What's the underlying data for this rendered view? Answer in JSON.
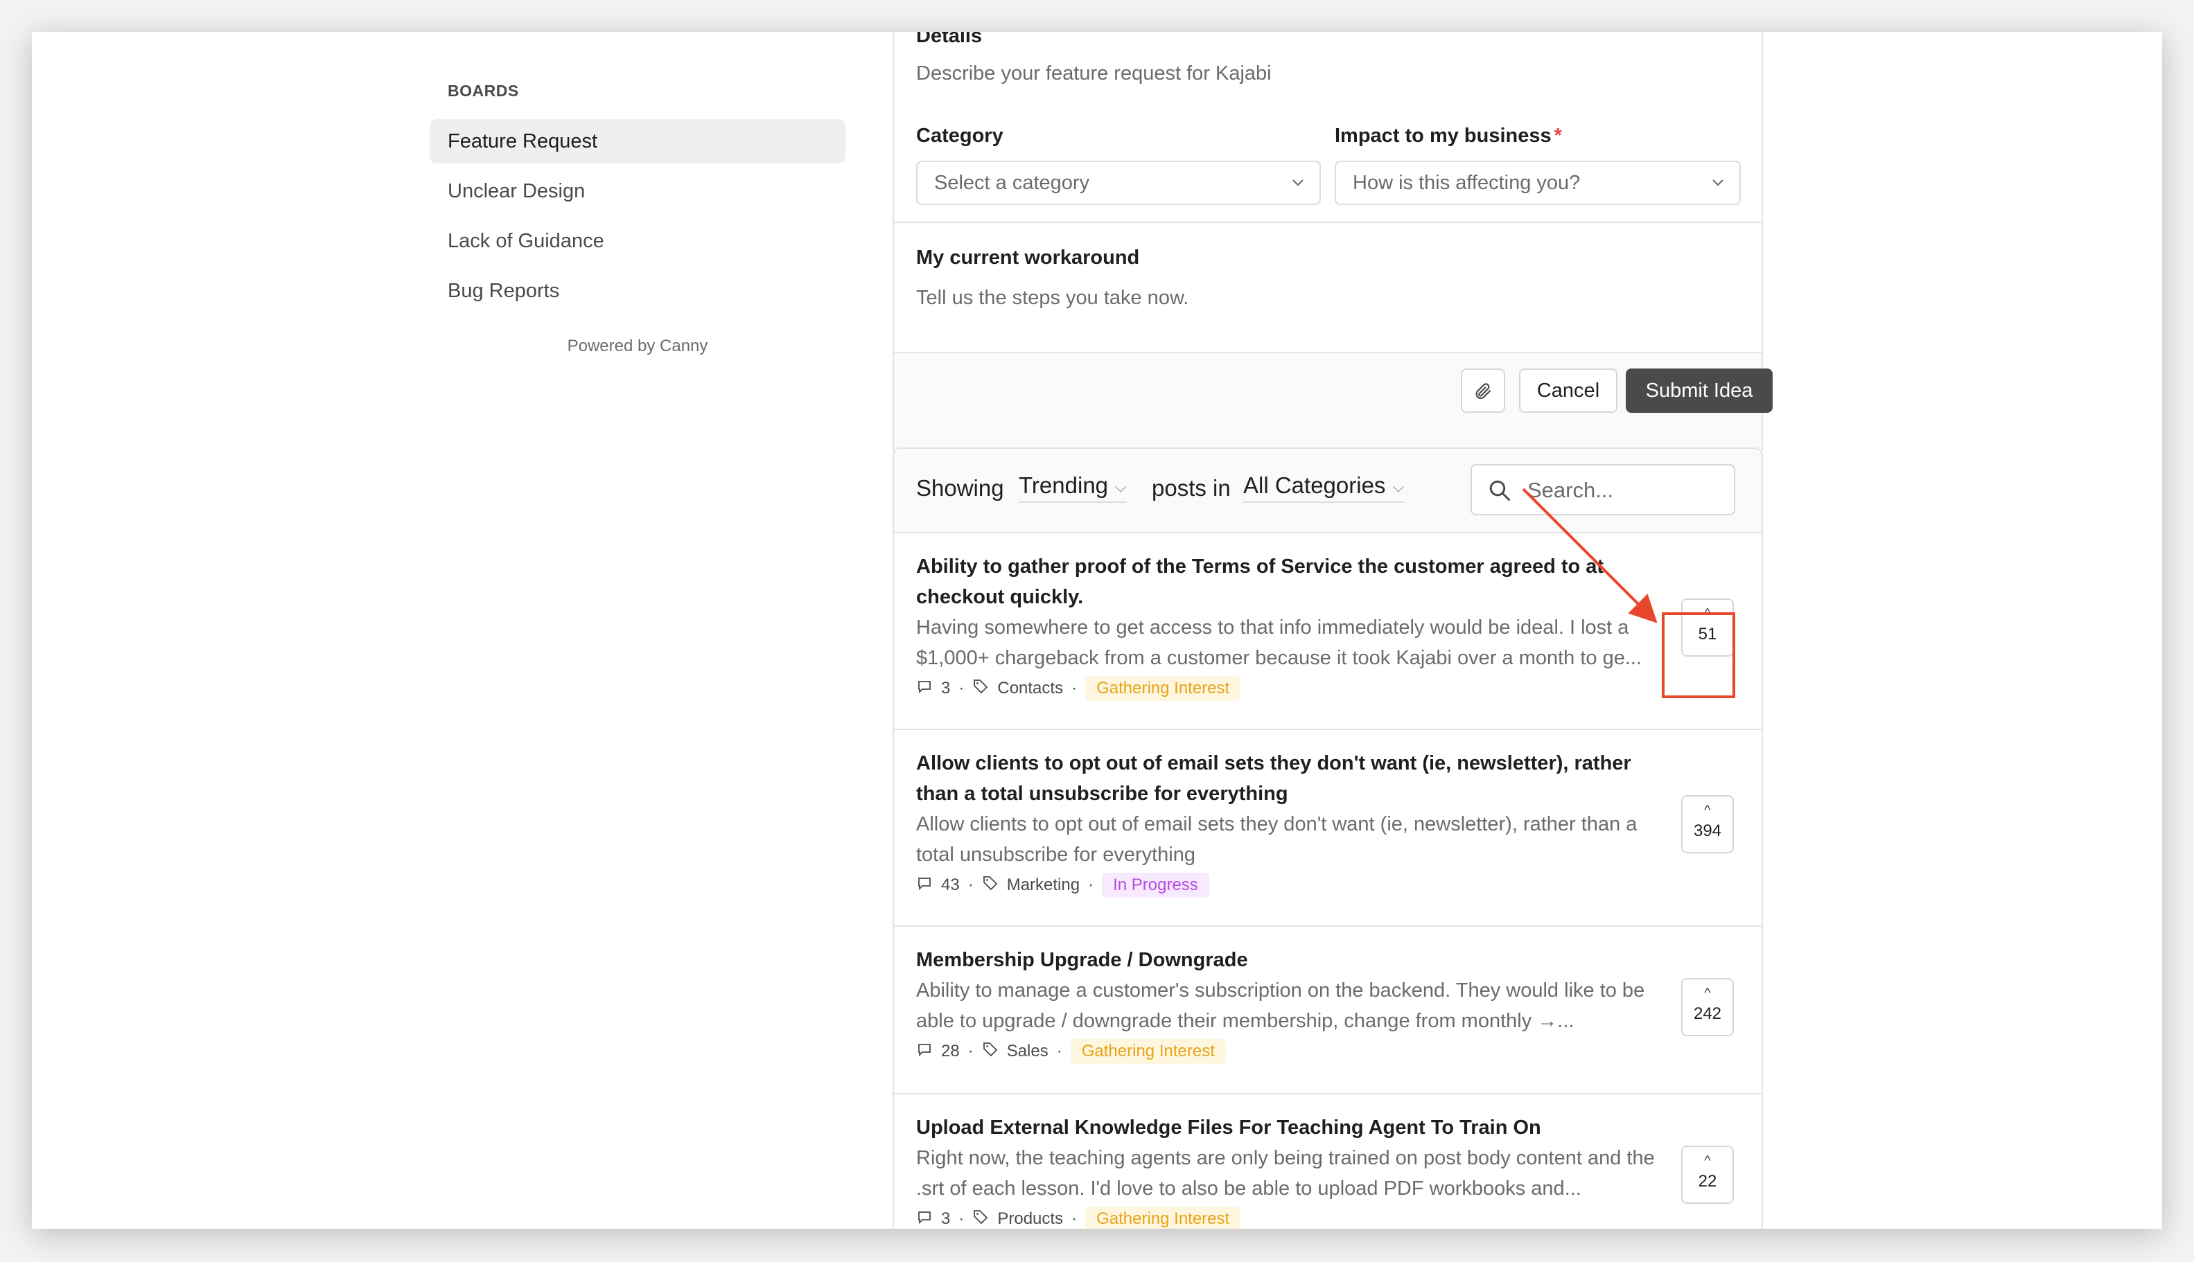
{
  "sidebar": {
    "heading": "BOARDS",
    "items": [
      {
        "label": "Feature Request",
        "active": true
      },
      {
        "label": "Unclear Design",
        "active": false
      },
      {
        "label": "Lack of Guidance",
        "active": false
      },
      {
        "label": "Bug Reports",
        "active": false
      }
    ],
    "powered_by": "Powered by Canny"
  },
  "form": {
    "details_label": "Details",
    "details_placeholder": "Describe your feature request for Kajabi",
    "category_label": "Category",
    "category_placeholder": "Select a category",
    "impact_label": "Impact to my business",
    "impact_required_mark": "*",
    "impact_placeholder": "How is this affecting you?",
    "workaround_label": "My current workaround",
    "workaround_placeholder": "Tell us the steps you take now.",
    "cancel_label": "Cancel",
    "submit_label": "Submit Idea"
  },
  "posts_header": {
    "showing": "Showing",
    "sort_value": "Trending",
    "posts_in": "posts in",
    "category_value": "All Categories",
    "search_placeholder": "Search..."
  },
  "posts": [
    {
      "title": "Ability to gather proof of the Terms of Service the customer agreed to at checkout quickly.",
      "body": "Having somewhere to get access to that info immediately would be ideal. I lost a $1,000+ chargeback from a customer because it took Kajabi over a month to ge...",
      "comments": "3",
      "tag": "Contacts",
      "status": "Gathering Interest",
      "votes": "51"
    },
    {
      "title": "Allow clients to opt out of email sets they don't want (ie, newsletter), rather than a total unsubscribe for everything",
      "body": "Allow clients to opt out of email sets they don't want (ie, newsletter), rather than a total unsubscribe for everything",
      "comments": "43",
      "tag": "Marketing",
      "status": "In Progress",
      "votes": "394"
    },
    {
      "title": "Membership Upgrade / Downgrade",
      "body": "Ability to manage a customer's subscription on the backend. They would like to be able to upgrade / downgrade their membership, change from monthly →...",
      "comments": "28",
      "tag": "Sales",
      "status": "Gathering Interest",
      "votes": "242"
    },
    {
      "title": "Upload External Knowledge Files For Teaching Agent To Train On",
      "body": "Right now, the teaching agents are only being trained on post body content and the .srt of each lesson. I'd love to also be able to upload PDF workbooks and...",
      "comments": "3",
      "tag": "Products",
      "status": "Gathering Interest",
      "votes": "22"
    }
  ],
  "colors": {
    "annotation": "#e8472b",
    "submit_bg": "#4a4a4a",
    "gathering_text": "#e8a317",
    "progress_text": "#b44be1"
  },
  "icons": [
    "search-icon",
    "attach-icon",
    "chevron-down-icon",
    "comment-icon",
    "tag-icon",
    "upvote-icon"
  ]
}
